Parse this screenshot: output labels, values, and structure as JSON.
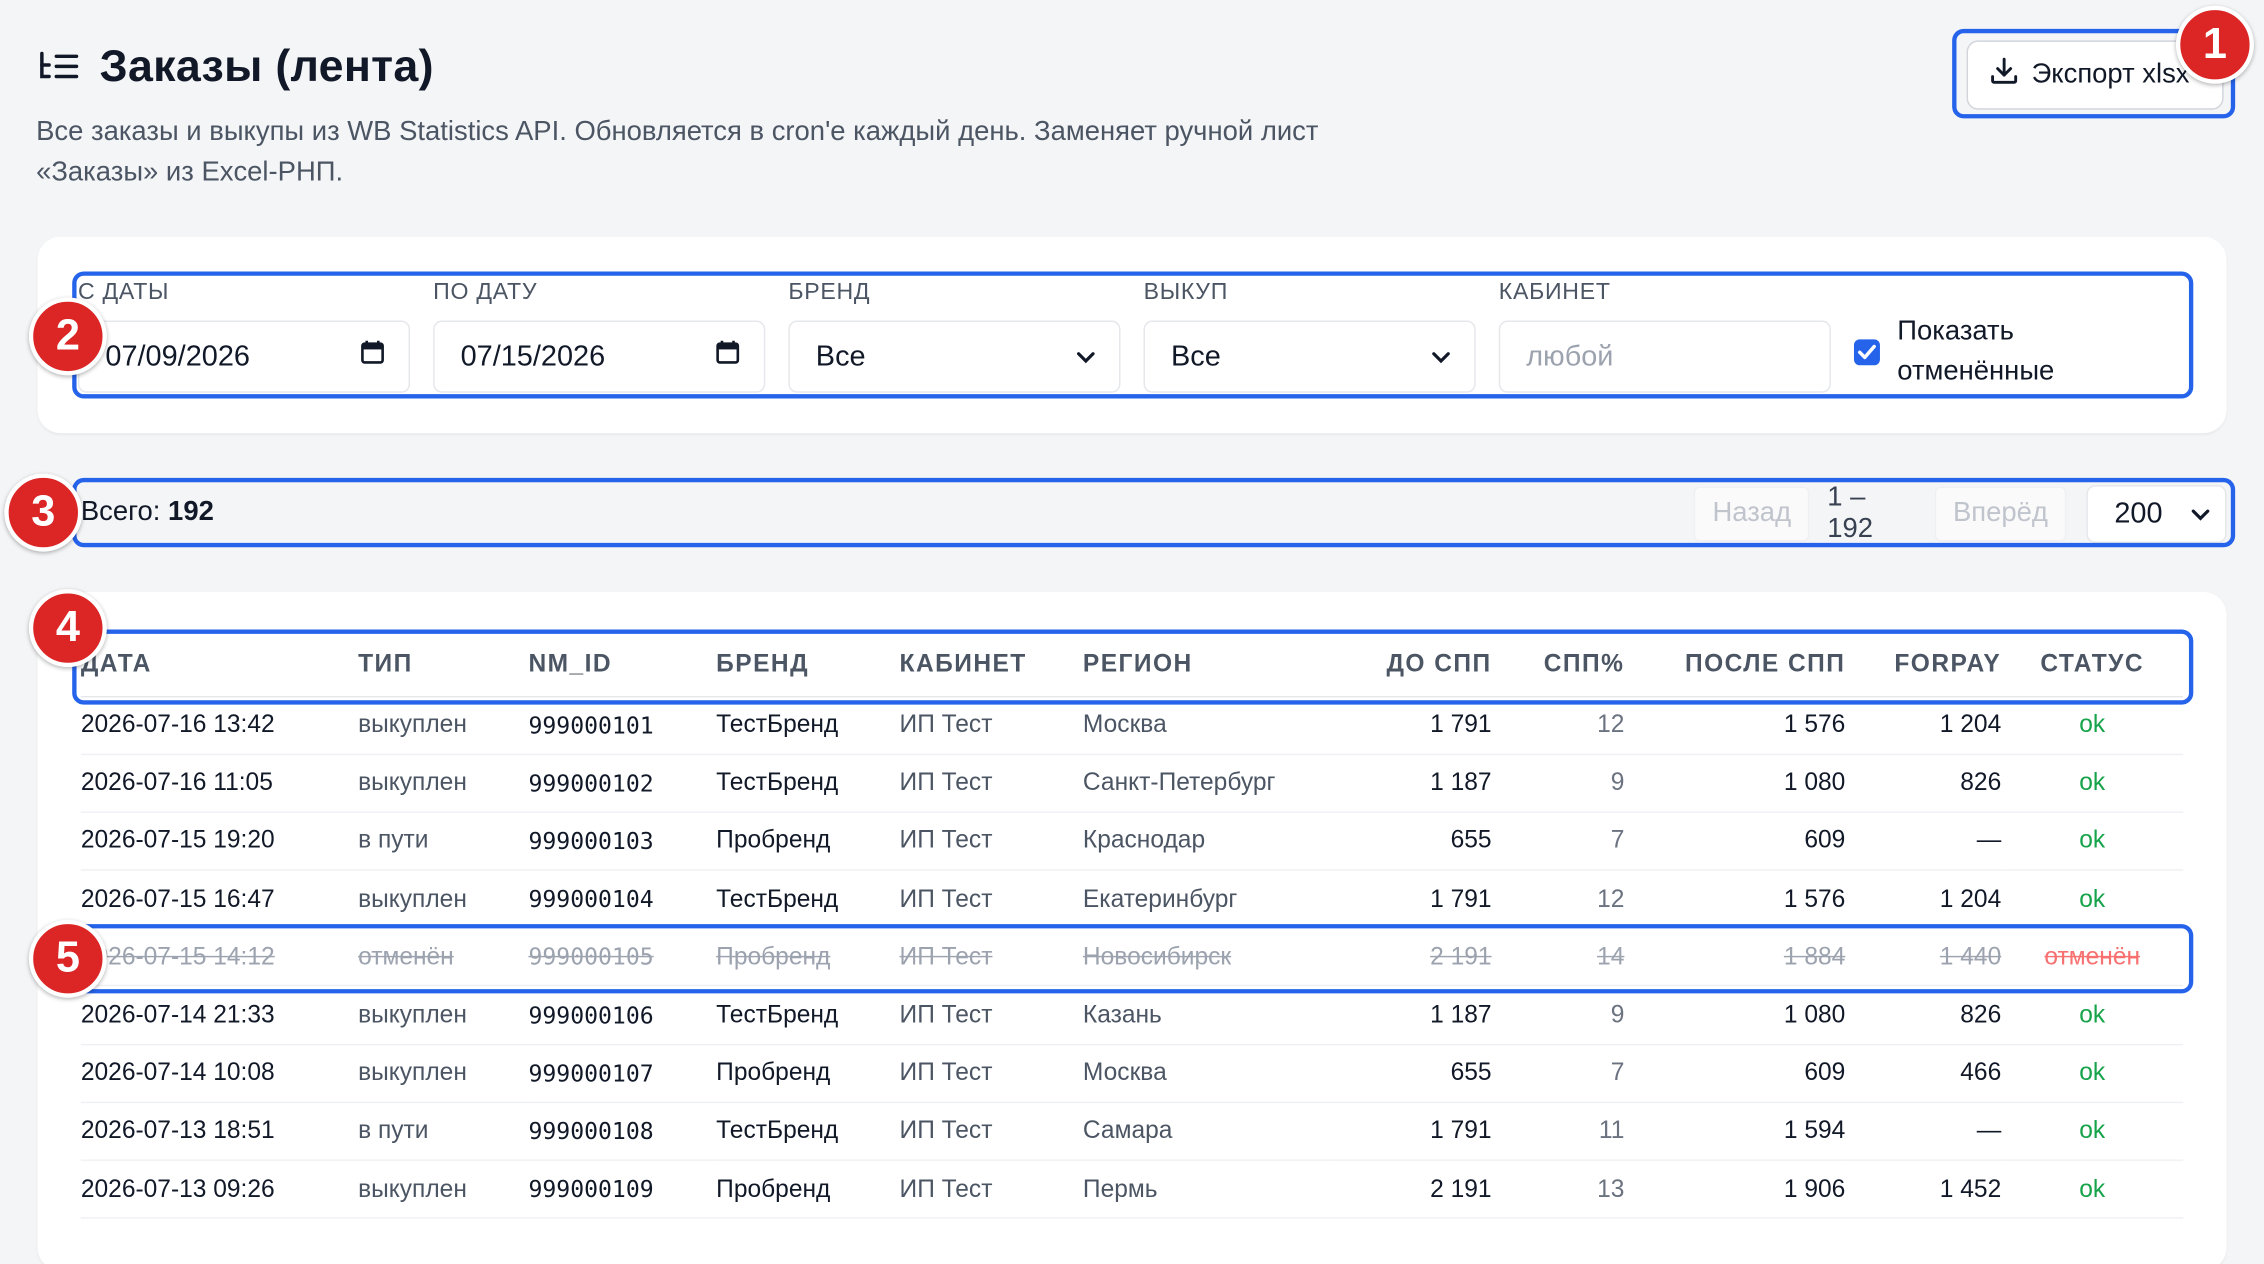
{
  "header": {
    "title": "Заказы (лента)",
    "subtitle": "Все заказы и выкупы из WB Statistics API. Обновляется в cron'е каждый день. Заменяет ручной лист «Заказы» из Excel-РНП.",
    "export_label": "Экспорт xlsx",
    "title_icon": "list-filter-icon",
    "export_icon": "download-icon"
  },
  "filters": {
    "date_from": {
      "label": "С ДАТЫ",
      "value": "07/09/2026"
    },
    "date_to": {
      "label": "ПО ДАТУ",
      "value": "07/15/2026"
    },
    "brand": {
      "label": "БРЕНД",
      "value": "Все"
    },
    "buyout": {
      "label": "ВЫКУП",
      "value": "Все"
    },
    "cabinet": {
      "label": "КАБИНЕТ",
      "placeholder": "любой"
    },
    "show_cancelled": {
      "label": "Показать отменённые",
      "checked": true
    }
  },
  "summary": {
    "total_label": "Всего:",
    "total_value": "192",
    "prev_label": "Назад",
    "range": "1 – 192",
    "next_label": "Вперёд",
    "page_size": "200"
  },
  "table": {
    "columns": [
      "ДАТА",
      "ТИП",
      "NM_ID",
      "БРЕНД",
      "КАБИНЕТ",
      "РЕГИОН",
      "ДО СПП",
      "СПП%",
      "ПОСЛЕ СПП",
      "FORPAY",
      "СТАТУС"
    ],
    "rows": [
      {
        "date": "2026-07-16 13:42",
        "type": "выкуплен",
        "nm_id": "999000101",
        "brand": "ТестБренд",
        "cabinet": "ИП Тест",
        "region": "Москва",
        "before": "1 791",
        "spp": "12",
        "after": "1 576",
        "forpay": "1 204",
        "status": "ok"
      },
      {
        "date": "2026-07-16 11:05",
        "type": "выкуплен",
        "nm_id": "999000102",
        "brand": "ТестБренд",
        "cabinet": "ИП Тест",
        "region": "Санкт-Петербург",
        "before": "1 187",
        "spp": "9",
        "after": "1 080",
        "forpay": "826",
        "status": "ok"
      },
      {
        "date": "2026-07-15 19:20",
        "type": "в пути",
        "nm_id": "999000103",
        "brand": "Пробренд",
        "cabinet": "ИП Тест",
        "region": "Краснодар",
        "before": "655",
        "spp": "7",
        "after": "609",
        "forpay": "—",
        "status": "ok"
      },
      {
        "date": "2026-07-15 16:47",
        "type": "выкуплен",
        "nm_id": "999000104",
        "brand": "ТестБренд",
        "cabinet": "ИП Тест",
        "region": "Екатеринбург",
        "before": "1 791",
        "spp": "12",
        "after": "1 576",
        "forpay": "1 204",
        "status": "ok"
      },
      {
        "date": "2026-07-15 14:12",
        "type": "отменён",
        "nm_id": "999000105",
        "brand": "Пробренд",
        "cabinet": "ИП Тест",
        "region": "Новосибирск",
        "before": "2 191",
        "spp": "14",
        "after": "1 884",
        "forpay": "1 440",
        "status": "отменён"
      },
      {
        "date": "2026-07-14 21:33",
        "type": "выкуплен",
        "nm_id": "999000106",
        "brand": "ТестБренд",
        "cabinet": "ИП Тест",
        "region": "Казань",
        "before": "1 187",
        "spp": "9",
        "after": "1 080",
        "forpay": "826",
        "status": "ok"
      },
      {
        "date": "2026-07-14 10:08",
        "type": "выкуплен",
        "nm_id": "999000107",
        "brand": "Пробренд",
        "cabinet": "ИП Тест",
        "region": "Москва",
        "before": "655",
        "spp": "7",
        "after": "609",
        "forpay": "466",
        "status": "ok"
      },
      {
        "date": "2026-07-13 18:51",
        "type": "в пути",
        "nm_id": "999000108",
        "brand": "ТестБренд",
        "cabinet": "ИП Тест",
        "region": "Самара",
        "before": "1 791",
        "spp": "11",
        "after": "1 594",
        "forpay": "—",
        "status": "ok"
      },
      {
        "date": "2026-07-13 09:26",
        "type": "выкуплен",
        "nm_id": "999000109",
        "brand": "Пробренд",
        "cabinet": "ИП Тест",
        "region": "Пермь",
        "before": "2 191",
        "spp": "13",
        "after": "1 906",
        "forpay": "1 452",
        "status": "ok"
      }
    ]
  },
  "annotations": [
    "1",
    "2",
    "3",
    "4",
    "5"
  ],
  "colors": {
    "accent": "#2563eb",
    "ok": "#16a34a",
    "cancel": "#f87171",
    "badge": "#dc2626"
  }
}
